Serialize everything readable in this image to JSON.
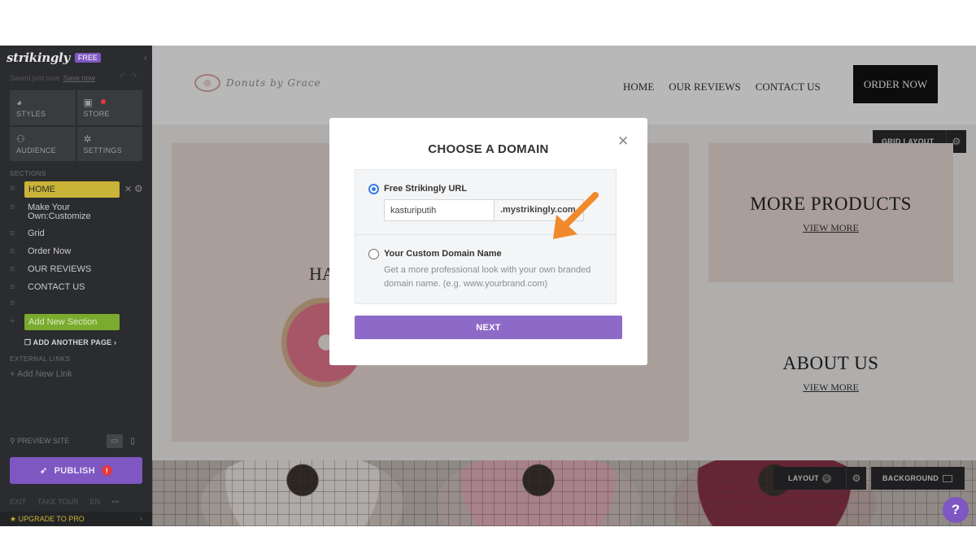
{
  "sidebar": {
    "brand": "strikingly",
    "badge": "FREE",
    "saved_text": "Saved just now.",
    "saved_link": "Save now",
    "tiles": [
      {
        "label": "STYLES",
        "icon": "palette-icon"
      },
      {
        "label": "STORE",
        "icon": "bag-icon"
      },
      {
        "label": "AUDIENCE",
        "icon": "people-icon"
      },
      {
        "label": "SETTINGS",
        "icon": "gear-icon"
      }
    ],
    "sections_heading": "SECTIONS",
    "sections": [
      {
        "label": "HOME"
      },
      {
        "label": "Make Your Own:Customize"
      },
      {
        "label": "Grid"
      },
      {
        "label": "Order Now"
      },
      {
        "label": "OUR REVIEWS"
      },
      {
        "label": "CONTACT US"
      }
    ],
    "add_section": "Add New Section",
    "add_page": "ADD ANOTHER PAGE",
    "external_heading": "EXTERNAL LINKS",
    "add_link": "Add New Link",
    "preview": "PREVIEW SITE",
    "publish": "PUBLISH",
    "bottom": [
      "EXIT",
      "TAKE TOUR",
      "EN"
    ],
    "upgrade": "UPGRADE TO PRO"
  },
  "site": {
    "logo_text": "Donuts by Grace",
    "nav": [
      "HOME",
      "OUR REVIEWS",
      "CONTACT US"
    ],
    "order_button": "ORDER NOW",
    "grid_layout": "GRID LAYOUT",
    "hero_partial": "HA",
    "cards": [
      {
        "title": "MORE PRODUCTS",
        "link": "VIEW MORE"
      },
      {
        "title": "ABOUT US",
        "link": "VIEW MORE"
      }
    ],
    "layout_button": "LAYOUT",
    "layout_badge": "G",
    "background_button": "BACKGROUND",
    "help": "?"
  },
  "modal": {
    "title": "CHOOSE A DOMAIN",
    "option_free_label": "Free Strikingly URL",
    "url_value": "kasturiputih",
    "url_suffix": ".mystrikingly.com",
    "option_custom_label": "Your Custom Domain Name",
    "option_custom_desc": "Get a more professional look with your own branded domain name. (e.g. www.yourbrand.com)",
    "next_button": "NEXT"
  },
  "colors": {
    "accent": "#7e57c2",
    "arrow": "#f08a2c",
    "home_pill": "#c9b437",
    "add_section": "#7bab2e"
  }
}
